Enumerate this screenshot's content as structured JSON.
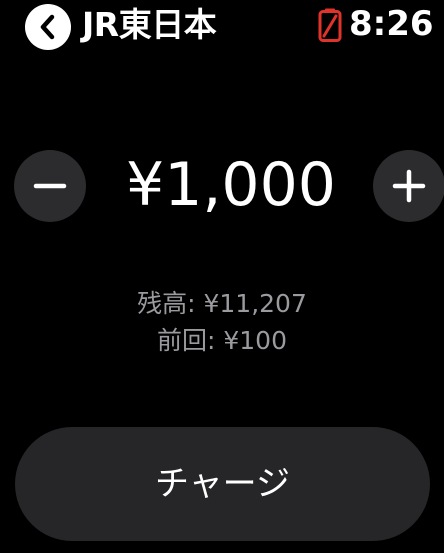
{
  "status_bar": {
    "app_title": "JR東日本",
    "time": "8:26",
    "battery_icon": "battery-low-icon",
    "battery_color": "#e0332c",
    "back_icon": "chevron-left-icon"
  },
  "stepper": {
    "amount": "¥1,000",
    "decrement_icon": "minus-icon",
    "increment_icon": "plus-icon"
  },
  "info": {
    "balance": "残高: ¥11,207",
    "last_charge": "前回: ¥100"
  },
  "charge_button": {
    "label": "チャージ"
  }
}
